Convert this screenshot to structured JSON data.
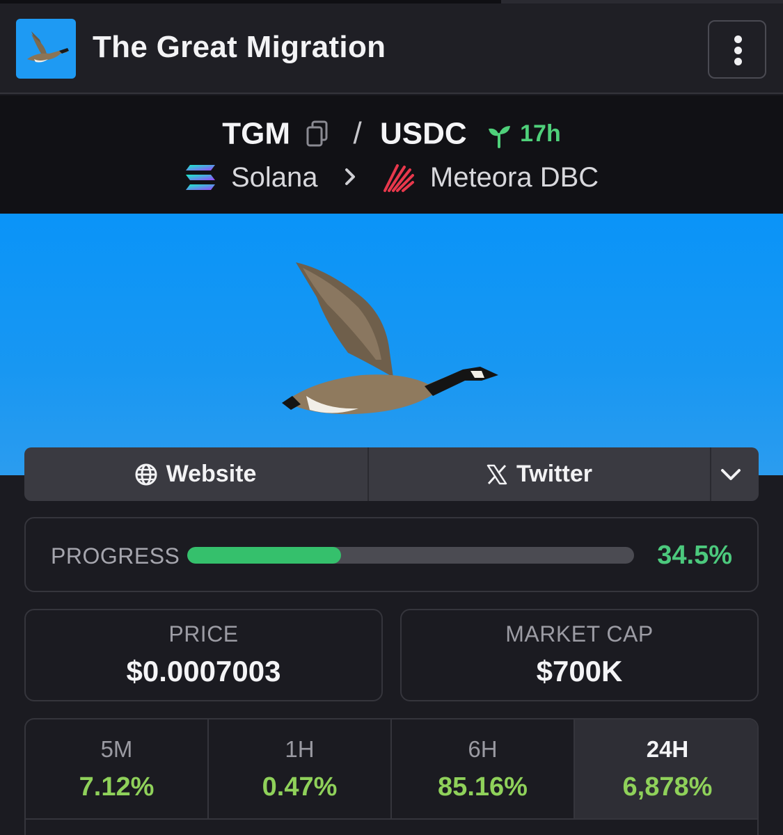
{
  "header": {
    "title": "The Great Migration"
  },
  "pair": {
    "base": "TGM",
    "separator": "/",
    "quote": "USDC",
    "age": "17h",
    "chain": "Solana",
    "dex": "Meteora DBC"
  },
  "links": {
    "website": "Website",
    "twitter": "Twitter"
  },
  "progress": {
    "label": "PROGRESS",
    "value_text": "34.5%",
    "fraction": 0.345
  },
  "stats": {
    "price_label": "PRICE",
    "price_value": "$0.0007003",
    "mcap_label": "MARKET CAP",
    "mcap_value": "$700K"
  },
  "timeframes": [
    {
      "label": "5M",
      "value": "7.12%"
    },
    {
      "label": "1H",
      "value": "0.47%"
    },
    {
      "label": "6H",
      "value": "85.16%"
    },
    {
      "label": "24H",
      "value": "6,878%",
      "active": true
    }
  ],
  "colors": {
    "accent_green": "#4cc97d",
    "change_green": "#8fd15a",
    "banner_blue": "#0a94f8"
  },
  "icons": [
    "goose-logo-icon",
    "kebab-menu-icon",
    "copy-icon",
    "sprout-icon",
    "solana-icon",
    "chevron-right-icon",
    "meteora-icon",
    "globe-icon",
    "x-logo-icon",
    "chevron-down-icon"
  ]
}
